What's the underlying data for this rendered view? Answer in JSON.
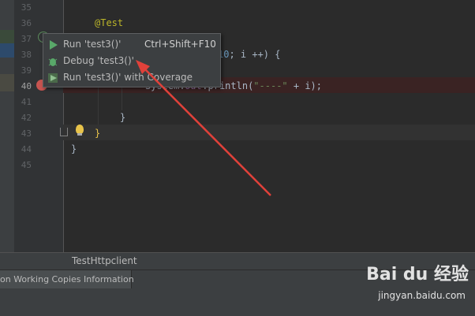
{
  "editor": {
    "line_numbers": [
      "35",
      "36",
      "37",
      "38",
      "39",
      "40",
      "41",
      "42",
      "43",
      "44",
      "45"
    ],
    "lines": {
      "l36": "@Test",
      "l37_tail": "",
      "l38_tail": "< 10; i ++) {",
      "l40_a": "System.",
      "l40_field": "out",
      "l40_b": ".println(",
      "l40_str": "\"----\"",
      "l40_c": " + i);",
      "l42": "}",
      "l43": "}",
      "l44": "}"
    },
    "highlighted_literal": "10"
  },
  "context_menu": {
    "items": [
      {
        "label": "Run 'test3()'",
        "shortcut": "Ctrl+Shift+F10",
        "icon": "run-icon"
      },
      {
        "label": "Debug 'test3()'",
        "shortcut": "",
        "icon": "debug-icon"
      },
      {
        "label": "Run 'test3()' with Coverage",
        "shortcut": "",
        "icon": "coverage-icon"
      }
    ]
  },
  "file_tab": {
    "label": "TestHttpclient"
  },
  "tool_window": {
    "label": "on Working Copies Information"
  },
  "watermark": {
    "brand": "Bai du 经验",
    "url": "jingyan.baidu.com"
  },
  "colors": {
    "background": "#2b2b2b",
    "gutter": "#313335",
    "annotation": "#bbb529",
    "number": "#6897bb",
    "string": "#6a8759",
    "breakpoint": "#c75450",
    "arrow": "#e0413a"
  }
}
